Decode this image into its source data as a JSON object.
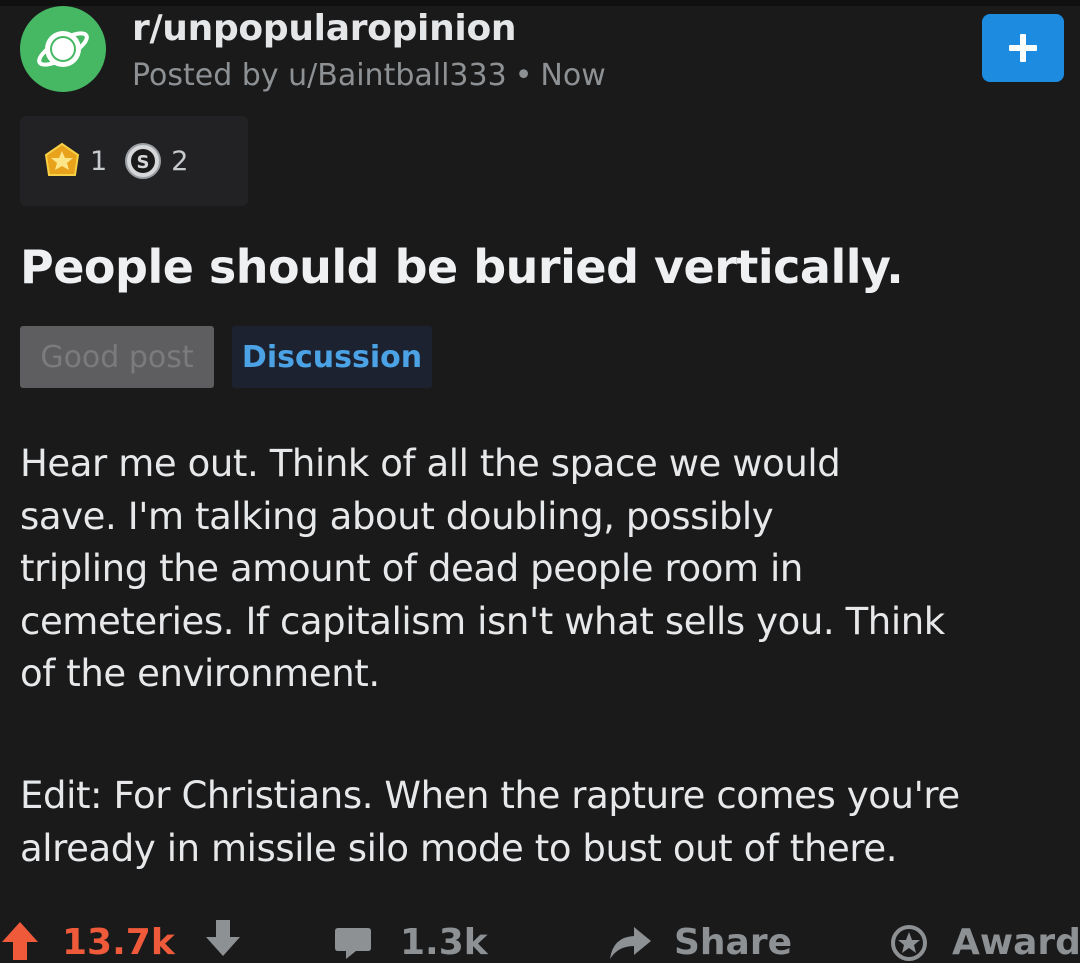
{
  "post": {
    "subreddit": "r/unpopularopinion",
    "posted_by": "Posted by u/Baintball333",
    "separator": "•",
    "time": "Now",
    "join_icon": "plus-icon",
    "awards": [
      {
        "icon": "gold-award-icon",
        "count": "1"
      },
      {
        "icon": "silver-award-icon",
        "count": "2"
      }
    ],
    "title": "People should be buried vertically.",
    "flairs": {
      "good_post": "Good post",
      "discussion": "Discussion"
    },
    "body_lines": [
      "Hear me out. Think of all the space we would",
      "save. I'm talking about doubling, possibly",
      "tripling the amount of dead people room in",
      "cemeteries. If capitalism isn't what sells you. Think",
      "of the environment."
    ],
    "edit_lines": [
      "Edit: For Christians. When the rapture comes you're",
      "already in missile silo mode to bust out of there."
    ]
  },
  "actions": {
    "score": "13.7k",
    "comments": "1.3k",
    "share": "Share",
    "award": "Award"
  },
  "colors": {
    "background": "#1a1a1b",
    "avatar": "#46b864",
    "join_button": "#1d8be0",
    "upvote": "#ef5a3a",
    "discussion_flair": "#4ba3e6"
  }
}
